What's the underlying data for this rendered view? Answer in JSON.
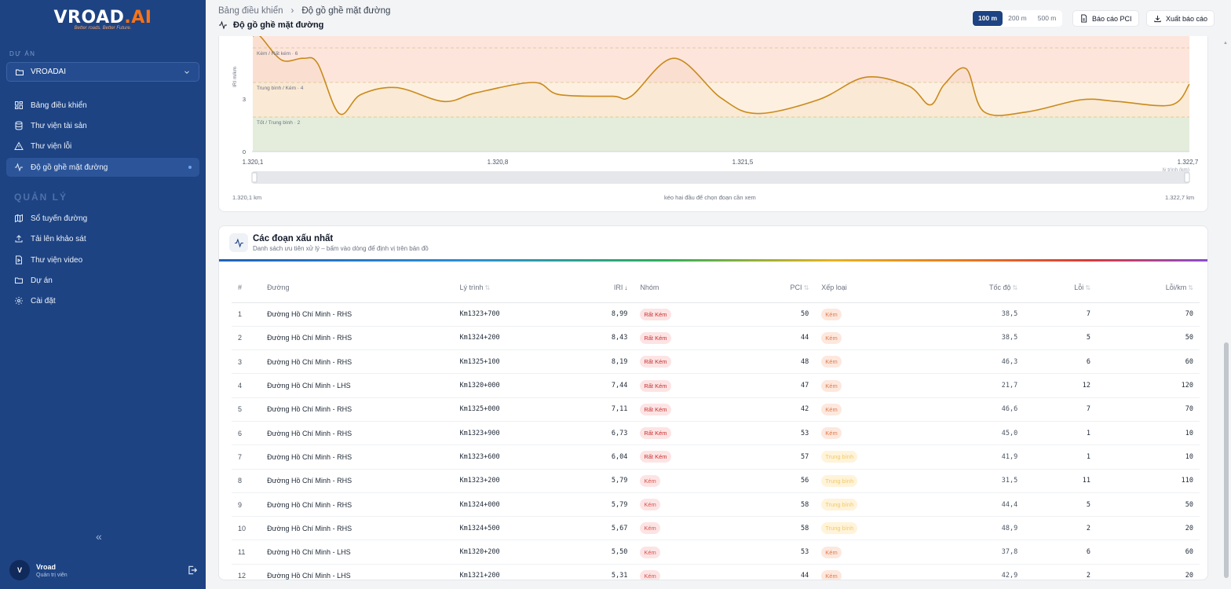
{
  "app": {
    "brand_main": "VROAD",
    "brand_ai": ".AI",
    "tagline": "Better roads. Better Future."
  },
  "sidebar": {
    "project_section": "DỰ ÁN",
    "project_selected": "VROADAI",
    "items": [
      {
        "label": "Bảng điều khiển",
        "icon": "dashboard-icon"
      },
      {
        "label": "Thư viện tài sản",
        "icon": "database-icon"
      },
      {
        "label": "Thư viện lỗi",
        "icon": "warning-icon"
      },
      {
        "label": "Độ gồ ghề mặt đường",
        "icon": "activity-icon",
        "active": true
      }
    ],
    "manage_section": "QUẢN LÝ",
    "manage_items": [
      {
        "label": "Sổ tuyến đường",
        "icon": "map-icon"
      },
      {
        "label": "Tải lên khảo sát",
        "icon": "upload-icon"
      },
      {
        "label": "Thư viện video",
        "icon": "video-file-icon"
      },
      {
        "label": "Dự án",
        "icon": "folder-icon"
      },
      {
        "label": "Cài đặt",
        "icon": "gear-icon"
      }
    ],
    "collapse_glyph": "«",
    "user": {
      "initial": "V",
      "name": "Vroad",
      "role": "Quản trị viên"
    }
  },
  "header": {
    "breadcrumb_root": "Bảng điều khiển",
    "breadcrumb_sep": "›",
    "breadcrumb_current": "Độ gồ ghề mặt đường",
    "title": "Độ gồ ghề mặt đường",
    "segments": [
      "100 m",
      "200 m",
      "500 m"
    ],
    "segment_active": "100 m",
    "btn_pci": "Báo cáo PCI",
    "btn_export": "Xuất báo cáo"
  },
  "chart": {
    "band_labels": {
      "bad": "Kém / Rất kém · 6",
      "mid": "Trung bình / Kém · 4",
      "good": "Tốt / Trung bình · 2"
    },
    "y_label": "IRI m/km",
    "x_label": "lý trình (km)",
    "range_left": "1.320,1 km",
    "range_hint": "kéo hai đầu để chọn đoạn cần xem",
    "range_right": "1.322,7 km",
    "colors": {
      "line": "#c98a1b",
      "good": "#e6f4e8",
      "mid": "#fdf0e0",
      "bad": "#fde5dc"
    }
  },
  "chart_data": {
    "type": "area",
    "xlabel": "lý trình (km)",
    "ylabel": "IRI m/km",
    "xlim": [
      1320.1,
      1322.7
    ],
    "x_tick_labels": [
      "1.320,1",
      "1.320,8",
      "1.321,5",
      "1.322,7"
    ],
    "y_tick_labels": [
      "0",
      "3"
    ],
    "thresholds": [
      2,
      4,
      6
    ],
    "series": [
      {
        "values_x": [
          1320.1,
          1320.12,
          1320.18,
          1320.24,
          1320.28,
          1320.34,
          1320.4,
          1320.5,
          1320.63,
          1320.72,
          1320.88,
          1320.95,
          1321.1,
          1321.15,
          1321.27,
          1321.4,
          1321.5,
          1321.67,
          1321.8,
          1321.92,
          1321.98,
          1322.02,
          1322.08,
          1322.13,
          1322.25,
          1322.4,
          1322.5,
          1322.65,
          1322.7
        ],
        "values_y": [
          6.8,
          7.2,
          5.3,
          5.4,
          5.1,
          2.2,
          3.3,
          3.7,
          2.9,
          3.4,
          4.0,
          3.3,
          3.2,
          3.2,
          5.4,
          3.1,
          2.2,
          3.0,
          4.3,
          3.8,
          2.7,
          3.9,
          4.8,
          2.3,
          2.3,
          3.0,
          2.9,
          2.7,
          3.9
        ]
      }
    ]
  },
  "table": {
    "title": "Các đoạn xấu nhất",
    "subtitle": "Danh sách ưu tiên xử lý – bấm vào dòng để định vị trên bản đồ",
    "columns": {
      "idx": "#",
      "road": "Đường",
      "chainage": "Lý trình",
      "iri": "IRI",
      "group": "Nhóm",
      "pci": "PCI",
      "grade": "Xếp loại",
      "speed": "Tốc độ",
      "defects": "Lỗi",
      "defects_per_km": "Lỗi/km"
    },
    "rows": [
      {
        "idx": "1",
        "road": "Đường Hồ Chí Minh - RHS",
        "chainage": "Km1323+700",
        "iri": "8,99",
        "group": "Rất Kém",
        "pci": "50",
        "grade": "Kém",
        "speed": "38,5",
        "defects": "7",
        "dpk": "70"
      },
      {
        "idx": "2",
        "road": "Đường Hồ Chí Minh - RHS",
        "chainage": "Km1324+200",
        "iri": "8,43",
        "group": "Rất Kém",
        "pci": "44",
        "grade": "Kém",
        "speed": "38,5",
        "defects": "5",
        "dpk": "50"
      },
      {
        "idx": "3",
        "road": "Đường Hồ Chí Minh - RHS",
        "chainage": "Km1325+100",
        "iri": "8,19",
        "group": "Rất Kém",
        "pci": "48",
        "grade": "Kém",
        "speed": "46,3",
        "defects": "6",
        "dpk": "60"
      },
      {
        "idx": "4",
        "road": "Đường Hồ Chí Minh - LHS",
        "chainage": "Km1320+000",
        "iri": "7,44",
        "group": "Rất Kém",
        "pci": "47",
        "grade": "Kém",
        "speed": "21,7",
        "defects": "12",
        "dpk": "120"
      },
      {
        "idx": "5",
        "road": "Đường Hồ Chí Minh - RHS",
        "chainage": "Km1325+000",
        "iri": "7,11",
        "group": "Rất Kém",
        "pci": "42",
        "grade": "Kém",
        "speed": "46,6",
        "defects": "7",
        "dpk": "70"
      },
      {
        "idx": "6",
        "road": "Đường Hồ Chí Minh - RHS",
        "chainage": "Km1323+900",
        "iri": "6,73",
        "group": "Rất Kém",
        "pci": "53",
        "grade": "Kém",
        "speed": "45,0",
        "defects": "1",
        "dpk": "10"
      },
      {
        "idx": "7",
        "road": "Đường Hồ Chí Minh - RHS",
        "chainage": "Km1323+600",
        "iri": "6,04",
        "group": "Rất Kém",
        "pci": "57",
        "grade": "Trung bình",
        "speed": "41,9",
        "defects": "1",
        "dpk": "10"
      },
      {
        "idx": "8",
        "road": "Đường Hồ Chí Minh - RHS",
        "chainage": "Km1323+200",
        "iri": "5,79",
        "group": "Kém",
        "pci": "56",
        "grade": "Trung bình",
        "speed": "31,5",
        "defects": "11",
        "dpk": "110"
      },
      {
        "idx": "9",
        "road": "Đường Hồ Chí Minh - RHS",
        "chainage": "Km1324+000",
        "iri": "5,79",
        "group": "Kém",
        "pci": "58",
        "grade": "Trung bình",
        "speed": "44,4",
        "defects": "5",
        "dpk": "50"
      },
      {
        "idx": "10",
        "road": "Đường Hồ Chí Minh - RHS",
        "chainage": "Km1324+500",
        "iri": "5,67",
        "group": "Kém",
        "pci": "58",
        "grade": "Trung bình",
        "speed": "48,9",
        "defects": "2",
        "dpk": "20"
      },
      {
        "idx": "11",
        "road": "Đường Hồ Chí Minh - LHS",
        "chainage": "Km1320+200",
        "iri": "5,50",
        "group": "Kém",
        "pci": "53",
        "grade": "Kém",
        "speed": "37,8",
        "defects": "6",
        "dpk": "60"
      },
      {
        "idx": "12",
        "road": "Đường Hồ Chí Minh - LHS",
        "chainage": "Km1321+200",
        "iri": "5,31",
        "group": "Kém",
        "pci": "44",
        "grade": "Kém",
        "speed": "42,9",
        "defects": "2",
        "dpk": "20"
      }
    ]
  }
}
